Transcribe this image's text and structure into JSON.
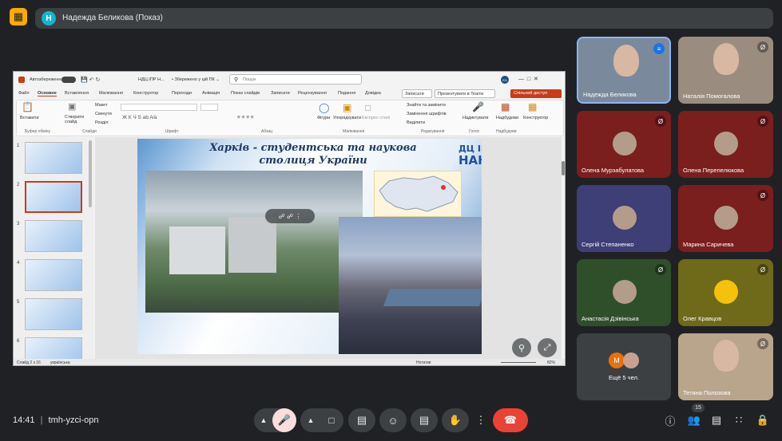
{
  "meeting": {
    "presenter_title": "Надежда Беликова (Показ)",
    "presenter_initial": "Н",
    "time": "14:41",
    "separator": "|",
    "code": "tmh-yzci-opn",
    "participant_count": "15"
  },
  "ppt": {
    "autosave": "Автозбереження",
    "doc_name": "НДЦ ІПР Н...",
    "saved_state": "• Збережено у цій ПК ⌄",
    "search_placeholder": "Пошук",
    "user_initials": "ЕН",
    "tabs": [
      "Файл",
      "Основне",
      "Вставлення",
      "Малювання",
      "Конструктор",
      "Переходи",
      "Анімація",
      "Показ слайдів",
      "Записати",
      "Рецензування",
      "Подання",
      "Довідка"
    ],
    "record_btn": "Записати",
    "teams_btn": "Презентувати в Teams",
    "share_btn": "Спільний доступ",
    "ribbon_groups": [
      "Буфер обміну",
      "Слайди",
      "Шрифт",
      "Абзац",
      "Малювання",
      "Редагування",
      "Голос",
      "Надбудови"
    ],
    "ribbon_buttons": {
      "paste": "Вставити",
      "new_slide": "Створити слайд",
      "layout": "Макет",
      "reset": "Скинути",
      "section": "Розділ",
      "shapes": "Фігури",
      "arrange": "Упорядкувати",
      "styles": "Експрес-стилі",
      "find": "Знайти та замінити",
      "replace_fonts": "Замінення шрифтів",
      "select": "Виділити",
      "dictate": "Надиктувати",
      "addins": "Надбудови",
      "designer": "Конструктор"
    },
    "thumb_numbers": [
      "1",
      "2",
      "3",
      "4",
      "5",
      "6"
    ],
    "status_left": "Слайд 2 з 16",
    "status_lang": "українська",
    "status_notes": "Нотатки",
    "zoom": "82%",
    "slide": {
      "title_line1": "Харків - студентська та наукова",
      "title_line2": "столиця України",
      "logo_line1": "ДЦ ІПР",
      "logo_line2": "НАНУ"
    }
  },
  "participants": [
    {
      "name": "Надежда Беликова",
      "muted": false
    },
    {
      "name": "Наталія Помогалова",
      "muted": true
    },
    {
      "name": "Олена Мурзабулатова",
      "muted": true
    },
    {
      "name": "Олена Перепелюкова",
      "muted": true
    },
    {
      "name": "Сергій Степаненко",
      "muted": false
    },
    {
      "name": "Марина Саричева",
      "muted": true
    },
    {
      "name": "Анастасія Дзівінська",
      "muted": true
    },
    {
      "name": "Олег Кравцов",
      "muted": true
    },
    {
      "name": "Ещё 5 чел.",
      "muted": false
    },
    {
      "name": "Тетяна Полозова",
      "muted": true
    }
  ],
  "more_initial": "M",
  "colors": {
    "accent": "#8ab4f8",
    "end_call": "#ea4335",
    "mic_off": "#f9dedc"
  }
}
